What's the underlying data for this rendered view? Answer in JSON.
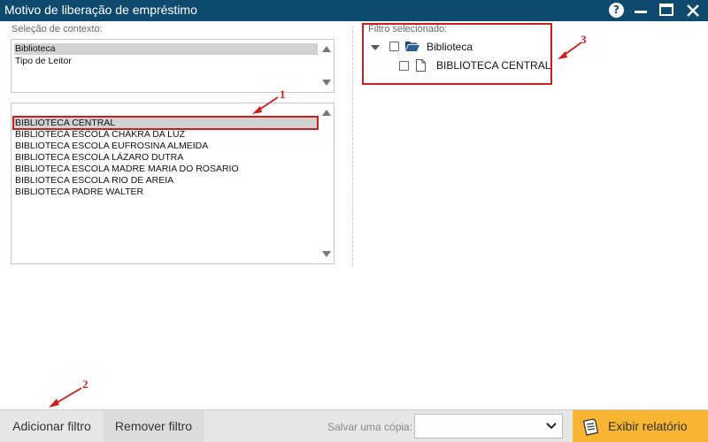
{
  "window": {
    "title": "Motivo de liberação de empréstimo",
    "help_glyph": "?",
    "accent_color": "#0d4a6e"
  },
  "context": {
    "label": "Seleção de contexto:",
    "items": [
      {
        "label": "Biblioteca",
        "selected": true
      },
      {
        "label": "Tipo de Leitor",
        "selected": false
      }
    ]
  },
  "libraries": {
    "items": [
      {
        "label": "BIBLIOTECA CENTRAL",
        "selected": true
      },
      {
        "label": "BIBLIOTECA ESCOLA CHAKRA DA LUZ",
        "selected": false
      },
      {
        "label": "BIBLIOTECA ESCOLA EUFROSINA ALMEIDA",
        "selected": false
      },
      {
        "label": "BIBLIOTECA ESCOLA LÁZARO DUTRA",
        "selected": false
      },
      {
        "label": "BIBLIOTECA ESCOLA MADRE MARIA DO ROSARIO",
        "selected": false
      },
      {
        "label": "BIBLIOTECA ESCOLA RIO DE AREIA",
        "selected": false
      },
      {
        "label": "BIBLIOTECA PADRE WALTER",
        "selected": false
      }
    ]
  },
  "filter": {
    "label": "Filtro selecionado:",
    "root": {
      "label": "Biblioteca",
      "icon": "folder-open-icon",
      "expanded": true,
      "checked": false
    },
    "children": [
      {
        "label": "BIBLIOTECA CENTRAL",
        "icon": "file-icon",
        "checked": false
      }
    ]
  },
  "annotations": {
    "n1": "1",
    "n2": "2",
    "n3": "3",
    "color": "#d11c1c"
  },
  "footer": {
    "add_filter": "Adicionar filtro",
    "remove_filter": "Remover filtro",
    "save_copy_label": "Salvar uma cópia:",
    "save_copy_value": "",
    "show_report": "Exibir relatório",
    "report_color": "#f7b531"
  }
}
